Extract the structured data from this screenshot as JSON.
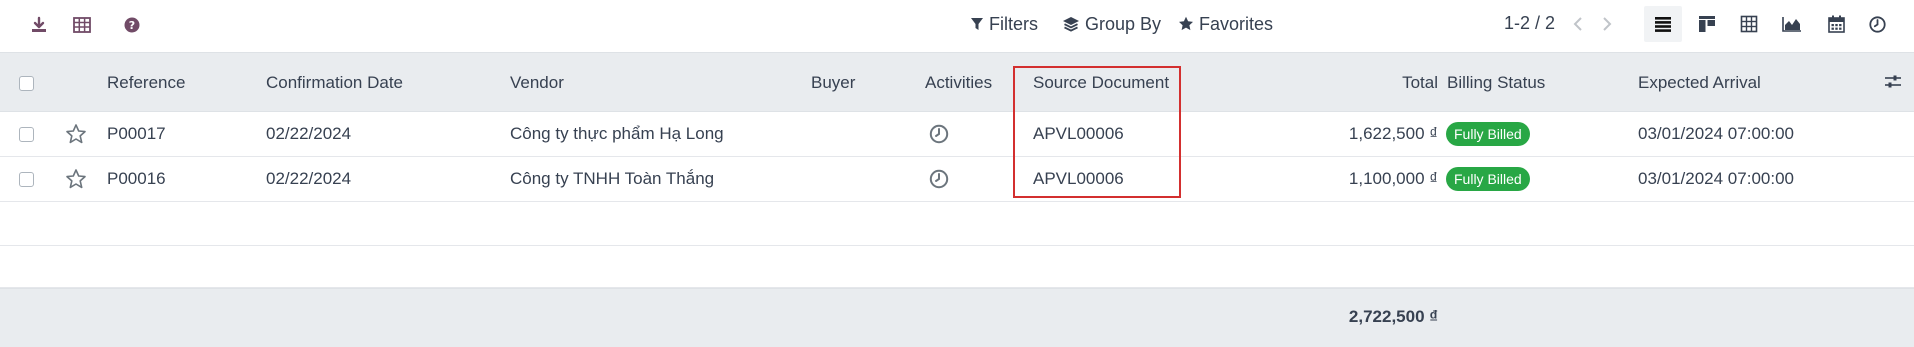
{
  "toolbar": {
    "icons": [
      "download-icon",
      "spreadsheet-icon",
      "help-icon"
    ],
    "filters_label": "Filters",
    "group_by_label": "Group By",
    "favorites_label": "Favorites",
    "pager_text": "1-2 / 2",
    "views": [
      "list-view",
      "kanban-view",
      "pivot-view",
      "graph-view",
      "calendar-view",
      "activity-view"
    ],
    "active_view": "list-view",
    "accent_color": "#714b67"
  },
  "table": {
    "columns": [
      "Reference",
      "Confirmation Date",
      "Vendor",
      "Buyer",
      "Activities",
      "Source Document",
      "Total",
      "Billing Status",
      "Expected Arrival"
    ],
    "rows": [
      {
        "reference": "P00017",
        "confirmation_date": "02/22/2024",
        "vendor": "Công ty thực phẩm Hạ Long",
        "buyer": "",
        "source_document": "APVL00006",
        "total": "1,622,500 ₫",
        "billing_status": "Fully Billed",
        "expected_arrival": "03/01/2024 07:00:00"
      },
      {
        "reference": "P00016",
        "confirmation_date": "02/22/2024",
        "vendor": "Công ty TNHH Toàn Thắng",
        "buyer": "",
        "source_document": "APVL00006",
        "total": "1,100,000 ₫",
        "billing_status": "Fully Billed",
        "expected_arrival": "03/01/2024 07:00:00"
      }
    ],
    "footer_total": "2,722,500 ₫",
    "badge_color": "#28a745",
    "highlight_color": "#d32f2f"
  }
}
